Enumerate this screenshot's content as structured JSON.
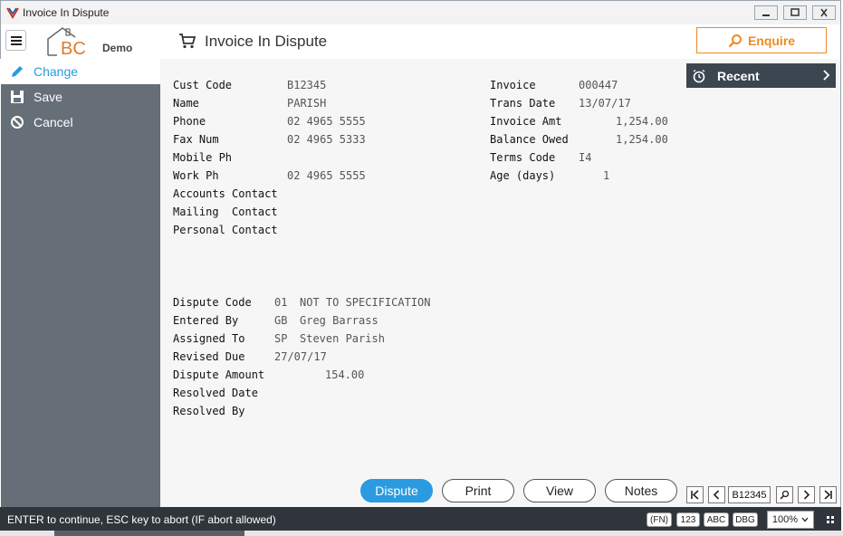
{
  "window": {
    "title": "Invoice In Dispute"
  },
  "header": {
    "logo_text": "BC",
    "logo_demo": "Demo",
    "page_title": "Invoice In Dispute",
    "enquire_label": "Enquire"
  },
  "sidebar": {
    "items": [
      {
        "label": "Change",
        "icon": "pencil-icon",
        "active": true
      },
      {
        "label": "Save",
        "icon": "floppy-disk-icon",
        "active": false
      },
      {
        "label": "Cancel",
        "icon": "cancel-circle-icon",
        "active": false
      }
    ]
  },
  "recent": {
    "label": "Recent"
  },
  "customer": {
    "labels": [
      "Cust Code",
      "Name",
      "Phone",
      "Fax Num",
      "Mobile Ph",
      "Work Ph",
      "Accounts Contact",
      "Mailing  Contact",
      "Personal Contact"
    ],
    "values": [
      "B12345",
      "PARISH",
      "02 4965 5555",
      "02 4965 5333",
      "",
      "02 4965 5555",
      "",
      "",
      ""
    ]
  },
  "invoice": {
    "labels": [
      "Invoice",
      "Trans Date",
      "Invoice Amt",
      "Balance Owed",
      "Terms Code",
      "Age (days)"
    ],
    "values": [
      "000447",
      "13/07/17",
      "1,254.00",
      "1,254.00",
      "I4",
      "1"
    ]
  },
  "dispute": {
    "labels": [
      "Dispute Code",
      "Entered By",
      "Assigned To",
      "Revised Due",
      "Dispute Amount",
      "Resolved Date",
      "Resolved By"
    ],
    "codes": [
      "01",
      "GB",
      "SP",
      "",
      "",
      "",
      ""
    ],
    "descriptions": [
      "NOT TO SPECIFICATION",
      "Greg Barrass",
      "Steven Parish",
      "",
      "",
      "",
      ""
    ],
    "revised_due": "27/07/17",
    "amount": "154.00"
  },
  "actions": {
    "dispute": "Dispute",
    "print": "Print",
    "view": "View",
    "notes": "Notes"
  },
  "navigator": {
    "current": "B12345"
  },
  "status": {
    "text": "ENTER to continue, ESC key to abort (IF abort allowed)",
    "badges": [
      "(FN)",
      "123",
      "ABC",
      "DBG"
    ],
    "zoom": "100%"
  },
  "colors": {
    "accent_blue": "#2a9be0",
    "enquire_orange": "#f08a24",
    "sidebar_bg": "#666e78",
    "statusbar_bg": "#2f353b"
  }
}
